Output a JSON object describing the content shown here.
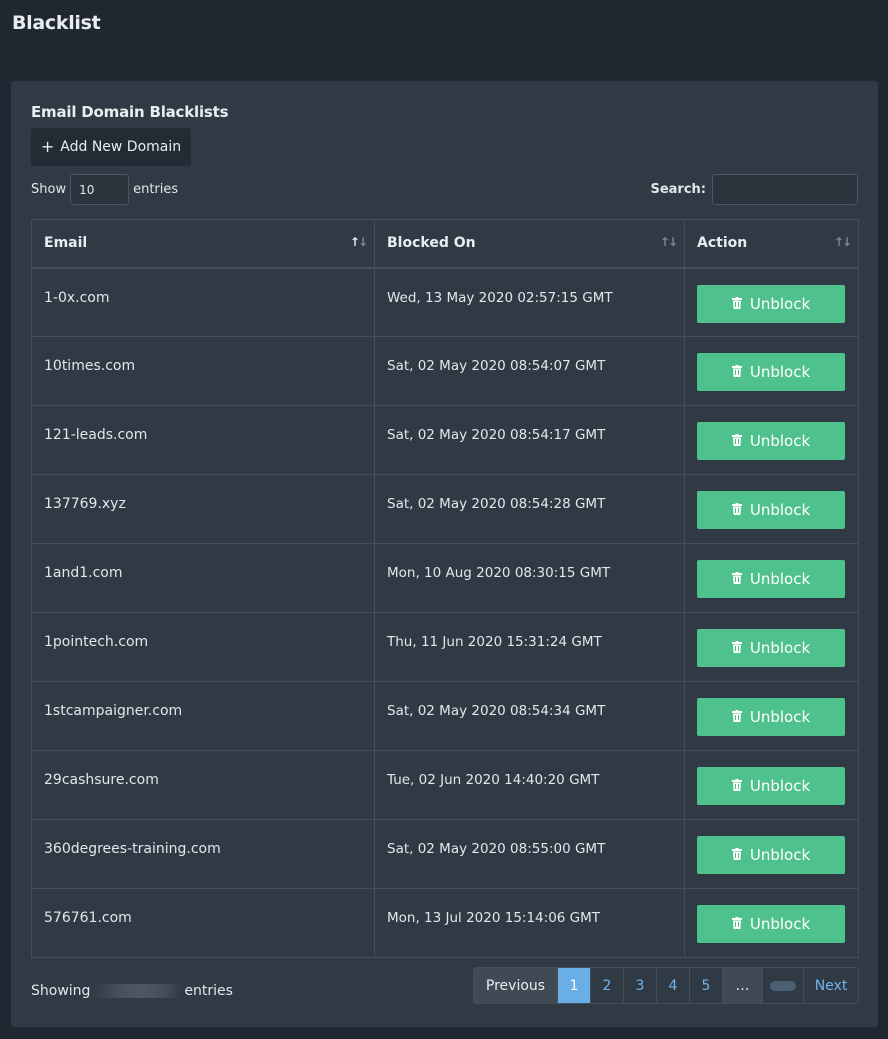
{
  "page": {
    "title": "Blacklist"
  },
  "card": {
    "title": "Email Domain Blacklists",
    "add_button": "Add New Domain",
    "show_label": "Show",
    "entries_label": "entries",
    "page_size": "10",
    "search_label": "Search:",
    "search_value": ""
  },
  "table": {
    "headers": [
      "Email",
      "Blocked On",
      "Action"
    ],
    "action_label": "Unblock",
    "rows": [
      {
        "email": "1-0x.com",
        "blocked_on": "Wed, 13 May 2020 02:57:15 GMT"
      },
      {
        "email": "10times.com",
        "blocked_on": "Sat, 02 May 2020 08:54:07 GMT"
      },
      {
        "email": "121-leads.com",
        "blocked_on": "Sat, 02 May 2020 08:54:17 GMT"
      },
      {
        "email": "137769.xyz",
        "blocked_on": "Sat, 02 May 2020 08:54:28 GMT"
      },
      {
        "email": "1and1.com",
        "blocked_on": "Mon, 10 Aug 2020 08:30:15 GMT"
      },
      {
        "email": "1pointech.com",
        "blocked_on": "Thu, 11 Jun 2020 15:31:24 GMT"
      },
      {
        "email": "1stcampaigner.com",
        "blocked_on": "Sat, 02 May 2020 08:54:34 GMT"
      },
      {
        "email": "29cashsure.com",
        "blocked_on": "Tue, 02 Jun 2020 14:40:20 GMT"
      },
      {
        "email": "360degrees-training.com",
        "blocked_on": "Sat, 02 May 2020 08:55:00 GMT"
      },
      {
        "email": "576761.com",
        "blocked_on": "Mon, 13 Jul 2020 15:14:06 GMT"
      }
    ]
  },
  "footer": {
    "showing_prefix": "Showing",
    "showing_suffix": "entries"
  },
  "pagination": {
    "previous": "Previous",
    "pages": [
      "1",
      "2",
      "3",
      "4",
      "5"
    ],
    "active_page": "1",
    "ellipsis": "…",
    "next": "Next"
  },
  "colors": {
    "background": "#1f2830",
    "card": "#2f3a44",
    "unblock_button": "#4fc18d",
    "pagination_active": "#69aee6",
    "link": "#73b3ec"
  }
}
